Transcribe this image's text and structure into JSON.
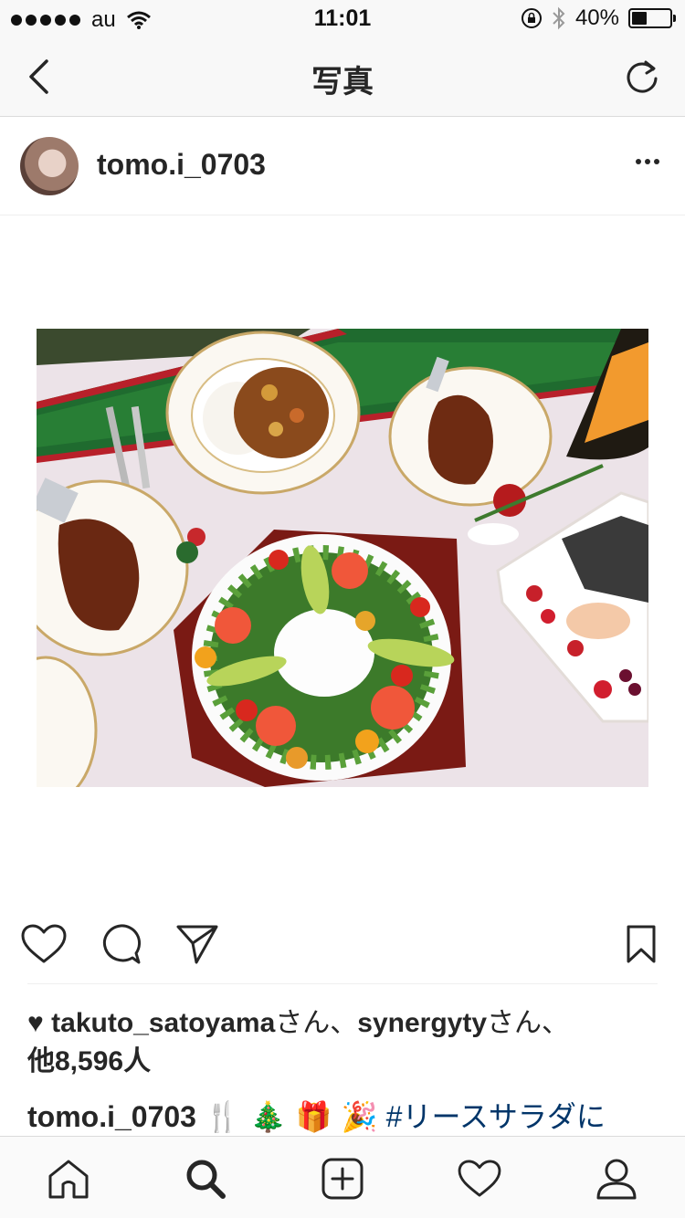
{
  "status_bar": {
    "carrier": "au",
    "time": "11:01",
    "battery_percent": "40%",
    "battery_level": 0.4,
    "icons": [
      "signal-dots-icon",
      "wifi-icon",
      "rotation-lock-icon",
      "bluetooth-icon",
      "battery-icon"
    ]
  },
  "nav": {
    "title": "写真",
    "back_icon": "chevron-left-icon",
    "refresh_icon": "refresh-icon"
  },
  "post": {
    "username": "tomo.i_0703",
    "more_icon": "more-dots-icon",
    "photo_alt": "Christmas dinner table: wreath salad, roast chicken legs, curry rice, champagne, cake"
  },
  "actions": {
    "icons": [
      "heart-icon",
      "comment-icon",
      "share-icon",
      "bookmark-icon"
    ]
  },
  "likes": {
    "heart": "♥",
    "user1": "takuto_satoyama",
    "san1": "さん、",
    "user2": "synergyty",
    "san2": "さん、",
    "others": "他8,596人"
  },
  "caption": {
    "username": "tomo.i_0703",
    "emojis": "🍴 🎄 🎁 🎉",
    "hashtag": "#リースサラダに"
  },
  "tabbar": {
    "icons": [
      "home-icon",
      "search-icon",
      "add-icon",
      "activity-heart-icon",
      "profile-icon"
    ]
  }
}
